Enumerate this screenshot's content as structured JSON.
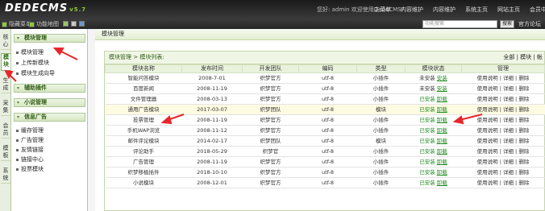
{
  "header": {
    "logo": "DEDECMS",
    "version": "v5.7",
    "welcome": "您好: admin 欢迎使用DedeCMS!",
    "nav": [
      "主菜单",
      "内容维护",
      "内容维护",
      "系统主页",
      "网站主页",
      "会员中心"
    ]
  },
  "subbar": {
    "link1": "隐藏菜单",
    "link2": "功能地图",
    "search_placeholder": "功能搜索",
    "search_button": "搜索",
    "official": "官方论坛"
  },
  "vtabs": [
    "核心",
    "模块",
    "生成",
    "采集",
    "会员",
    "模板",
    "系统"
  ],
  "leftmenu": {
    "group1": "模块管理",
    "group1_items": [
      "模块管理",
      "上传新模块",
      "模块生成向导"
    ],
    "group2": "辅助插件",
    "group3": "小说管理",
    "group4": "信息广告",
    "group4_items": [
      "缓存管理",
      "广告管理",
      "友情链接",
      "链接中心",
      "投票模块"
    ]
  },
  "main": {
    "page_title": "模块管理",
    "breadcrumb": "模块管理 > 模块列表:",
    "filters": "全部 | 模块 | 帐",
    "columns": [
      "模块名称",
      "发布时间",
      "开发团队",
      "编码",
      "类型",
      "模块状态",
      "管理"
    ],
    "rows": [
      {
        "name": "智能问答模块",
        "date": "2008-7-01",
        "team": "织梦官方",
        "enc": "utf-8",
        "type": "小插件",
        "status": "未安装",
        "status2": "安装",
        "manage": "使用说明 | 详细 | 删除"
      },
      {
        "name": "百度新闻",
        "date": "2008-11-19",
        "team": "织梦官方",
        "enc": "utf-8",
        "type": "小插件",
        "status": "未安装",
        "status2": "安装",
        "manage": "使用说明 | 详细 | 删除"
      },
      {
        "name": "文件管理器",
        "date": "2008-03-13",
        "team": "织梦官方",
        "enc": "utf-8",
        "type": "小插件",
        "status": "已安装",
        "status2": "卸载",
        "manage": "使用说明 | 详细 | 删除"
      },
      {
        "name": "通用广告模块",
        "date": "2017-03-07",
        "team": "织梦团队",
        "enc": "utf-8",
        "type": "模块",
        "status": "已安装",
        "status2": "卸载",
        "manage": "使用说明 | 详细 | 删除"
      },
      {
        "name": "投票管理",
        "date": "2008-11-19",
        "team": "织梦官方",
        "enc": "utf-8",
        "type": "小插件",
        "status": "已安装",
        "status2": "卸载",
        "manage": "使用说明 | 详细 | 删除"
      },
      {
        "name": "手机WAP浏览",
        "date": "2008-11-12",
        "team": "织梦官方",
        "enc": "utf-8",
        "type": "小插件",
        "status": "已安装",
        "status2": "卸载",
        "manage": "使用说明 | 详细 | 删除"
      },
      {
        "name": "邮件评论模块",
        "date": "2014-02-17",
        "team": "织梦团队",
        "enc": "utf-8",
        "type": "模块",
        "status": "已安装",
        "status2": "卸载",
        "manage": "使用说明 | 详细 | 删除"
      },
      {
        "name": "评论助手",
        "date": "2018-05-29",
        "team": "织梦官",
        "enc": "utf-8",
        "type": "小插件",
        "status": "已安装",
        "status2": "卸载",
        "manage": "使用说明 | 详细 | 删除"
      },
      {
        "name": "广告管理",
        "date": "2008-11-19",
        "team": "织梦官方",
        "enc": "utf-8",
        "type": "小插件",
        "status": "已安装",
        "status2": "卸载",
        "manage": "使用说明 | 详细 | 删除"
      },
      {
        "name": "织梦移植插件",
        "date": "2018-10-10",
        "team": "织梦官方",
        "enc": "utf-8",
        "type": "小插件",
        "status": "已安装",
        "status2": "卸载",
        "manage": "使用说明 | 详细 | 删除"
      },
      {
        "name": "小说模块",
        "date": "2008-12-01",
        "team": "织梦官方",
        "enc": "utf-8",
        "type": "小插件",
        "status": "已安装",
        "status2": "卸载",
        "manage": "使用说明 | 详细 | 删除"
      }
    ]
  },
  "colors": {
    "accent": "#8fc93a",
    "annotation": "#e8262b",
    "header": "#222222"
  }
}
